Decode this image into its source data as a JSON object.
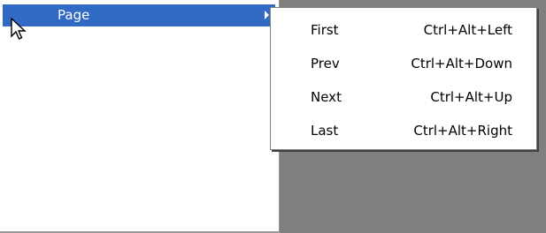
{
  "parent_menu": {
    "item": {
      "label": "Page"
    }
  },
  "submenu": {
    "items": [
      {
        "label": "First",
        "shortcut": "Ctrl+Alt+Left"
      },
      {
        "label": "Prev",
        "shortcut": "Ctrl+Alt+Down"
      },
      {
        "label": "Next",
        "shortcut": "Ctrl+Alt+Up"
      },
      {
        "label": "Last",
        "shortcut": "Ctrl+Alt+Right"
      }
    ]
  },
  "colors": {
    "highlight": "#316ac5",
    "desktop": "#7f7f7f",
    "menu_bg": "#ffffff"
  }
}
